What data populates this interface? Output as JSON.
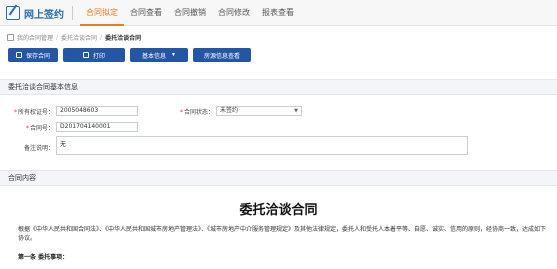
{
  "header": {
    "app_title": "网上签约",
    "nav": [
      {
        "label": "合同拟定",
        "active": true
      },
      {
        "label": "合同查看",
        "active": false
      },
      {
        "label": "合同撤销",
        "active": false
      },
      {
        "label": "合同修改",
        "active": false
      },
      {
        "label": "报表查看",
        "active": false
      }
    ]
  },
  "breadcrumb": {
    "items": [
      "我的合同管理",
      "委托洽谈合同"
    ],
    "current": "委托洽谈合同"
  },
  "toolbar": {
    "save_label": "保存合同",
    "print_label": "打印",
    "basic_info_label": "基本信息",
    "view_record_label": "房源信息查看"
  },
  "section_basic": {
    "title": "委托洽谈合同基本信息",
    "cert_no_label": "所有权证号：",
    "cert_no_value": "2005048603",
    "status_label": "合同状态：",
    "status_value": "未签约",
    "contract_no_label": "合同号：",
    "contract_no_value": "D201704140001",
    "remark_label": "备注说明：",
    "remark_value": "无"
  },
  "section_content": {
    "title": "合同内容",
    "doc_title": "委托洽谈合同",
    "paragraph": "根据《中华人民共和国合同法》、《中华人民共和国城市房地产管理法》、《城市房地产中介服务管理规定》及其他法律规定，委托人和受托人本着平等、自愿、诚实、信用的原则，经协商一致，达成如下协议。",
    "clause_one": "第一条 委托事项："
  },
  "colors": {
    "accent": "#e67e22",
    "primary": "#2456a6",
    "brand": "#2b6cb0"
  }
}
